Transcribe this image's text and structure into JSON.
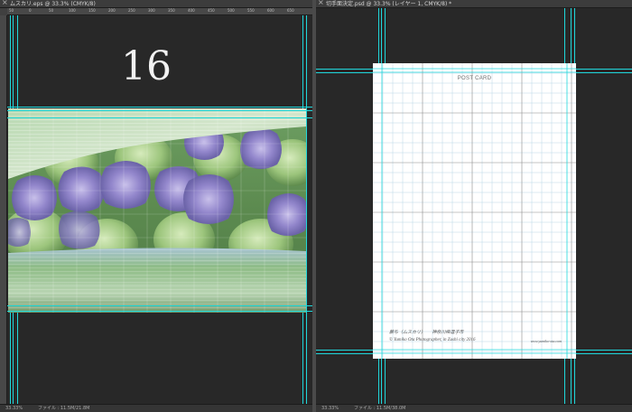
{
  "left_document": {
    "tab_close_glyph": "×",
    "tab_title": "ムスカリ.eps @ 33.3% (CMYK/8)",
    "ruler_labels": [
      "50",
      "0",
      "50",
      "100",
      "150",
      "200",
      "250",
      "300",
      "350",
      "400",
      "450",
      "500",
      "550",
      "600",
      "650"
    ],
    "page_number": "16",
    "photo_description_colors": {
      "lavender": "#8f86c8",
      "green": "#8fc070",
      "stripe_light": "#c8e0c4"
    },
    "status_zoom": "33.33%",
    "status_file": "ファイル : 11.5M/21.8M"
  },
  "right_document": {
    "tab_close_glyph": "×",
    "tab_title": "切手面決定.psd @ 33.3% (レイヤー 1, CMYK/8) *",
    "postcard_header": "POST CARD",
    "credit_line_1": "蕨ち（ムスカリ）　　神奈川県逗子市",
    "credit_line_2": "© Yumiko Ota Photographer, in Zushi city 2016",
    "credit_url": "www.yumiko-ota.com",
    "status_zoom": "33.33%",
    "status_file": "ファイル : 11.5M/38.0M"
  },
  "colors": {
    "canvas_bg": "#282828",
    "guide": "#20d8dc",
    "ruler": "#484848",
    "postcard": "#ffffff"
  }
}
